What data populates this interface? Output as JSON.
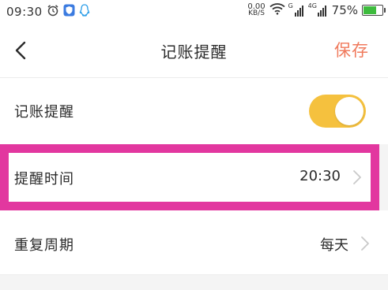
{
  "status_bar": {
    "time": "09:30",
    "net_speed_value": "0.00",
    "net_speed_unit": "KB/S",
    "signal1_label": "G",
    "signal2_label": "4G",
    "battery_text": "75%",
    "battery_level_fraction": 0.75,
    "icons": [
      "alarm-icon",
      "shield-icon",
      "qq-icon",
      "wifi-icon",
      "signal-icon",
      "signal-4g-icon",
      "battery-icon"
    ]
  },
  "header": {
    "title": "记账提醒",
    "save_label": "保存",
    "back_icon": "chevron-left-icon"
  },
  "settings": {
    "reminder_label": "记账提醒",
    "reminder_enabled": true,
    "time_label": "提醒时间",
    "time_value": "20:30",
    "repeat_label": "重复周期",
    "repeat_value": "每天"
  },
  "colors": {
    "accent": "#f07a5c",
    "toggle_on": "#f5c13e",
    "highlight_border": "#e2379f",
    "battery_fill": "#3dbb3d"
  }
}
